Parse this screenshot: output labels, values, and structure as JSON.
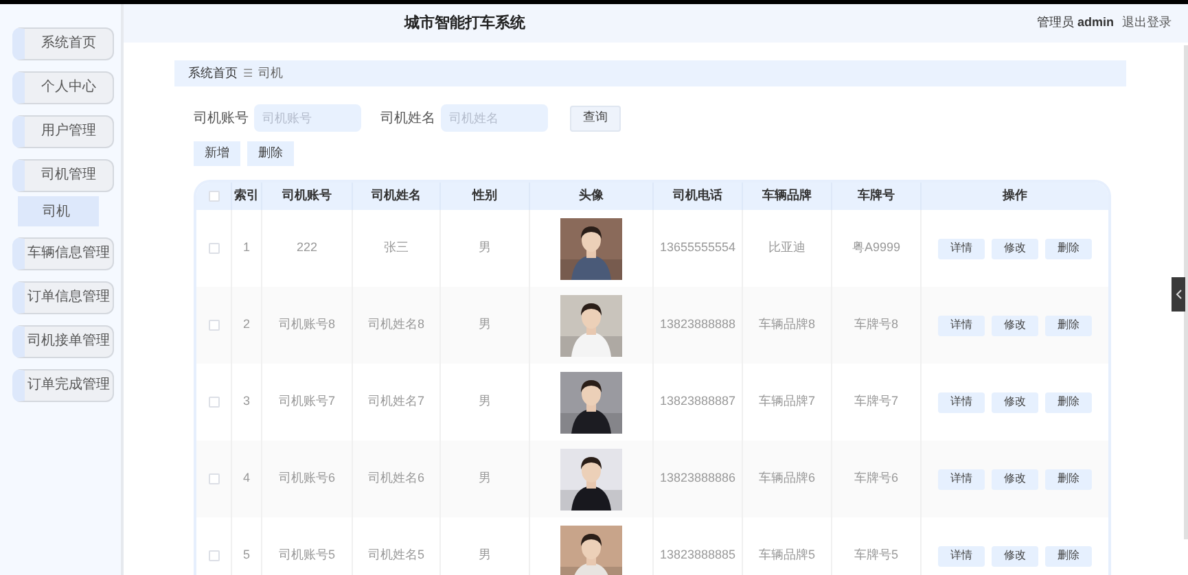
{
  "header": {
    "title": "城市智能打车系统",
    "role": "管理员",
    "user": "admin",
    "logout": "退出登录"
  },
  "sidebar": {
    "items": [
      {
        "label": "系统首页",
        "selected": false
      },
      {
        "label": "个人中心",
        "selected": false
      },
      {
        "label": "用户管理",
        "selected": false
      },
      {
        "label": "司机管理",
        "selected": false,
        "children": [
          {
            "label": "司机",
            "selected": true
          }
        ]
      },
      {
        "label": "车辆信息管理",
        "selected": false
      },
      {
        "label": "订单信息管理",
        "selected": false
      },
      {
        "label": "司机接单管理",
        "selected": false
      },
      {
        "label": "订单完成管理",
        "selected": false
      }
    ]
  },
  "breadcrumb": [
    "系统首页",
    "司机"
  ],
  "breadcrumb_separator": "☰",
  "search": {
    "fields": [
      {
        "label": "司机账号",
        "placeholder": "司机账号"
      },
      {
        "label": "司机姓名",
        "placeholder": "司机姓名"
      }
    ],
    "button": "查询"
  },
  "actions": [
    "新增",
    "删除"
  ],
  "table": {
    "columns": [
      "索引",
      "司机账号",
      "司机姓名",
      "性别",
      "头像",
      "司机电话",
      "车辆品牌",
      "车牌号",
      "操作"
    ],
    "header_checked": false,
    "rows": [
      {
        "checked": false,
        "index": "1",
        "account": "222",
        "name": "张三",
        "gender": "男",
        "phone": "13655555554",
        "brand": "比亚迪",
        "plate": "粤A9999",
        "actions": [
          "详情",
          "修改",
          "删除"
        ]
      },
      {
        "checked": false,
        "index": "2",
        "account": "司机账号8",
        "name": "司机姓名8",
        "gender": "男",
        "phone": "13823888888",
        "brand": "车辆品牌8",
        "plate": "车牌号8",
        "actions": [
          "详情",
          "修改",
          "删除"
        ]
      },
      {
        "checked": false,
        "index": "3",
        "account": "司机账号7",
        "name": "司机姓名7",
        "gender": "男",
        "phone": "13823888887",
        "brand": "车辆品牌7",
        "plate": "车牌号7",
        "actions": [
          "详情",
          "修改",
          "删除"
        ]
      },
      {
        "checked": false,
        "index": "4",
        "account": "司机账号6",
        "name": "司机姓名6",
        "gender": "男",
        "phone": "13823888886",
        "brand": "车辆品牌6",
        "plate": "车牌号6",
        "actions": [
          "详情",
          "修改",
          "删除"
        ]
      },
      {
        "checked": false,
        "index": "5",
        "account": "司机账号5",
        "name": "司机姓名5",
        "gender": "男",
        "phone": "13823888885",
        "brand": "车辆品牌5",
        "plate": "车牌号5",
        "actions": [
          "详情",
          "修改",
          "删除"
        ]
      }
    ]
  }
}
